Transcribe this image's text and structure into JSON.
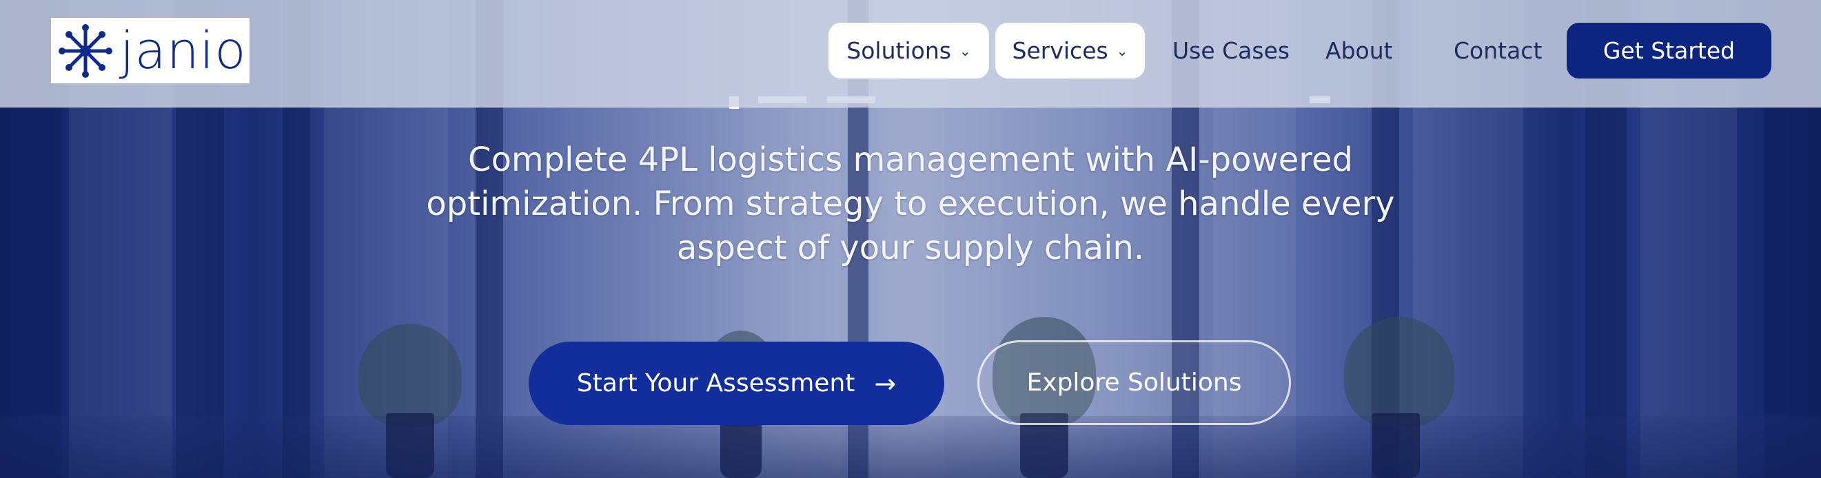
{
  "brand": {
    "name": "janio",
    "logo_icon": "starburst-icon",
    "color": "#0e2a8a"
  },
  "nav": {
    "solutions_label": "Solutions",
    "services_label": "Services",
    "use_cases_label": "Use Cases",
    "about_label": "About",
    "contact_label": "Contact",
    "get_started_label": "Get Started",
    "chevron_icon": "chevron-down-icon"
  },
  "hero": {
    "subtitle": "Complete 4PL logistics management with AI-powered optimization. From strategy to execution, we handle every aspect of your supply chain.",
    "primary_cta": "Start Your Assessment",
    "primary_cta_icon": "arrow-right-icon",
    "secondary_cta": "Explore Solutions"
  },
  "colors": {
    "primary": "#0b2580",
    "header_bg": "#cdd4e4",
    "text_dark": "#1d2c5e"
  }
}
